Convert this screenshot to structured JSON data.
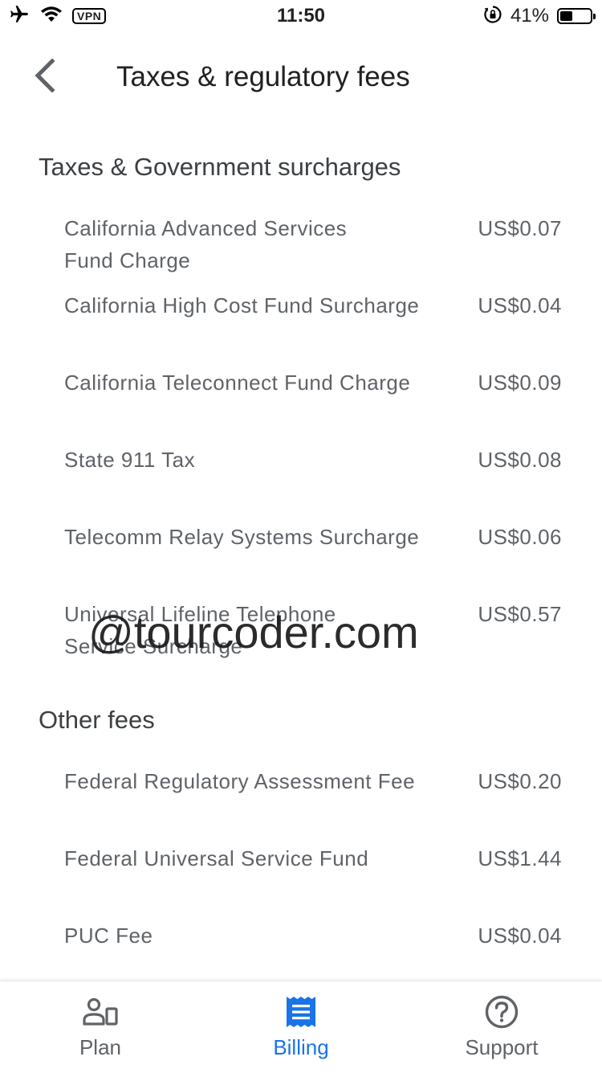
{
  "status_bar": {
    "vpn": "VPN",
    "time": "11:50",
    "battery_percent": "41%",
    "battery_level": 0.41
  },
  "header": {
    "title": "Taxes & regulatory fees",
    "back_icon": "chevron-left-icon"
  },
  "sections": [
    {
      "heading": "Taxes & Government surcharges",
      "rows": [
        {
          "label": "California Advanced Services Fund Charge",
          "amount": "US$0.07"
        },
        {
          "label": "California High Cost Fund Surcharge",
          "amount": "US$0.04"
        },
        {
          "label": "California Teleconnect Fund Charge",
          "amount": "US$0.09"
        },
        {
          "label": "State 911 Tax",
          "amount": "US$0.08"
        },
        {
          "label": "Telecomm Relay Systems Surcharge",
          "amount": "US$0.06"
        },
        {
          "label": "Universal Lifeline Telephone Service Surcharge",
          "amount": "US$0.57"
        }
      ]
    },
    {
      "heading": "Other fees",
      "rows": [
        {
          "label": "Federal Regulatory Assessment Fee",
          "amount": "US$0.20"
        },
        {
          "label": "Federal Universal Service Fund",
          "amount": "US$1.44"
        },
        {
          "label": "PUC Fee",
          "amount": "US$0.04"
        }
      ]
    }
  ],
  "watermark": "@tourcoder.com",
  "bottom_nav": {
    "items": [
      {
        "label": "Plan",
        "icon": "plan-icon",
        "active": false
      },
      {
        "label": "Billing",
        "icon": "billing-icon",
        "active": true
      },
      {
        "label": "Support",
        "icon": "help-circle-icon",
        "active": false
      }
    ]
  },
  "colors": {
    "accent": "#1a73e8",
    "text_secondary": "#5f6368",
    "text_primary": "#202124"
  }
}
